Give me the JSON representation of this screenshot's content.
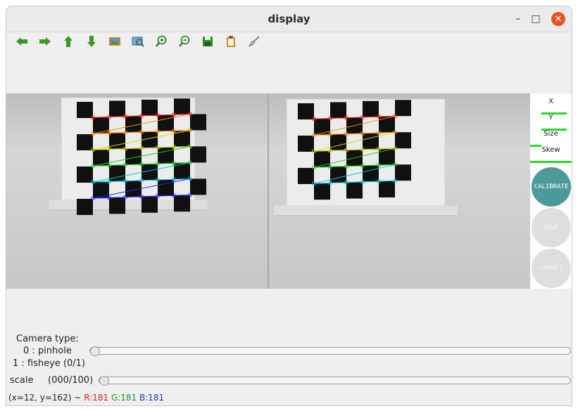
{
  "window": {
    "title": "display"
  },
  "toolbar": {
    "buttons": [
      {
        "name": "pan-left",
        "icon": "arrow-left-icon"
      },
      {
        "name": "pan-right",
        "icon": "arrow-right-icon"
      },
      {
        "name": "pan-up",
        "icon": "arrow-up-icon"
      },
      {
        "name": "pan-down",
        "icon": "arrow-down-icon"
      },
      {
        "name": "zoom-fit",
        "icon": "image-icon"
      },
      {
        "name": "zoom-region",
        "icon": "zoom-region-icon"
      },
      {
        "name": "zoom-in",
        "icon": "zoom-in-icon"
      },
      {
        "name": "zoom-out",
        "icon": "zoom-out-icon"
      },
      {
        "name": "save",
        "icon": "save-icon"
      },
      {
        "name": "copy",
        "icon": "clipboard-icon"
      },
      {
        "name": "properties",
        "icon": "brush-icon"
      }
    ]
  },
  "side_panel": {
    "metrics": [
      {
        "label": "X"
      },
      {
        "label": "Y"
      },
      {
        "label": "Size"
      },
      {
        "label": "Skew"
      }
    ],
    "bar_color": "#22dd22",
    "buttons": {
      "calibrate": "CALIBRATE",
      "save": "SAVE",
      "commit": "COMMIT"
    }
  },
  "controls": {
    "camera_type_line1": "Camera type:",
    "camera_type_line2": "0 : pinhole",
    "camera_type_line3": "1 : fisheye (0/1)",
    "camera_type_value": 0,
    "scale_label": "scale",
    "scale_value_text": "(000/100)",
    "scale_value": 0
  },
  "status": {
    "coords": "(x=12, y=162) ~",
    "r": "R:181",
    "g": "G:181",
    "b": "B:181"
  },
  "colors": {
    "calibrate_active": "#4c9a9a",
    "button_inactive": "#dedede",
    "close_button": "#e95420"
  }
}
